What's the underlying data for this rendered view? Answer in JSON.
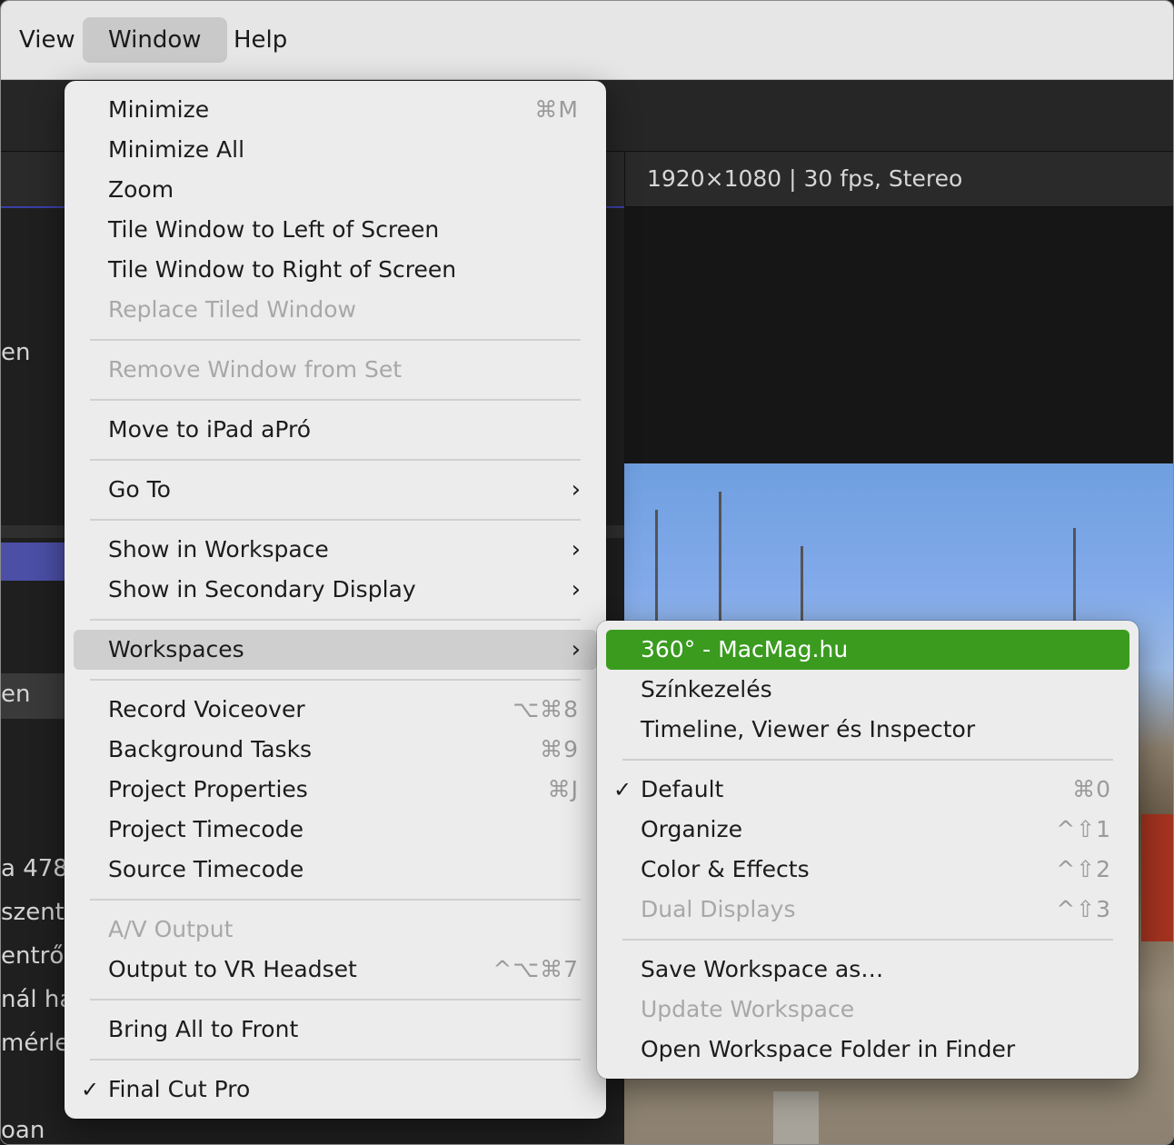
{
  "menubar": {
    "items": [
      "View",
      "Window",
      "Help"
    ]
  },
  "viewer": {
    "info": "1920×1080 | 30 fps, Stereo"
  },
  "left_fragments": [
    "en",
    "en",
    "a 478",
    "szentr",
    "entről",
    "nál ha",
    "mérle",
    "oan"
  ],
  "window_menu": {
    "items": [
      {
        "label": "Minimize",
        "shortcut": "⌘M"
      },
      {
        "label": "Minimize All"
      },
      {
        "label": "Zoom"
      },
      {
        "label": "Tile Window to Left of Screen"
      },
      {
        "label": "Tile Window to Right of Screen"
      },
      {
        "label": "Replace Tiled Window"
      },
      {
        "label": "Remove Window from Set"
      },
      {
        "label": "Move to iPad aPró"
      },
      {
        "label": "Go To"
      },
      {
        "label": "Show in Workspace"
      },
      {
        "label": "Show in Secondary Display"
      },
      {
        "label": "Workspaces"
      },
      {
        "label": "Record Voiceover",
        "shortcut": "⌥⌘8"
      },
      {
        "label": "Background Tasks",
        "shortcut": "⌘9"
      },
      {
        "label": "Project Properties",
        "shortcut": "⌘J"
      },
      {
        "label": "Project Timecode"
      },
      {
        "label": "Source Timecode"
      },
      {
        "label": "A/V Output"
      },
      {
        "label": "Output to VR Headset",
        "shortcut": "^⌥⌘7"
      },
      {
        "label": "Bring All to Front"
      },
      {
        "label": "Final Cut Pro",
        "check": "✓"
      }
    ]
  },
  "workspaces_submenu": {
    "items": [
      {
        "label": "360° - MacMag.hu"
      },
      {
        "label": "Színkezelés"
      },
      {
        "label": "Timeline, Viewer és Inspector"
      },
      {
        "label": "Default",
        "shortcut": "⌘0",
        "check": "✓"
      },
      {
        "label": "Organize",
        "shortcut": "^⇧1"
      },
      {
        "label": "Color & Effects",
        "shortcut": "^⇧2"
      },
      {
        "label": "Dual Displays",
        "shortcut": "^⇧3"
      },
      {
        "label": "Save Workspace as…"
      },
      {
        "label": "Update Workspace"
      },
      {
        "label": "Open Workspace Folder in Finder"
      }
    ]
  },
  "colors": {
    "selected": "#3a9b1f",
    "hover": "#cfcfcf",
    "disabled_text": "#a8a8a8"
  }
}
